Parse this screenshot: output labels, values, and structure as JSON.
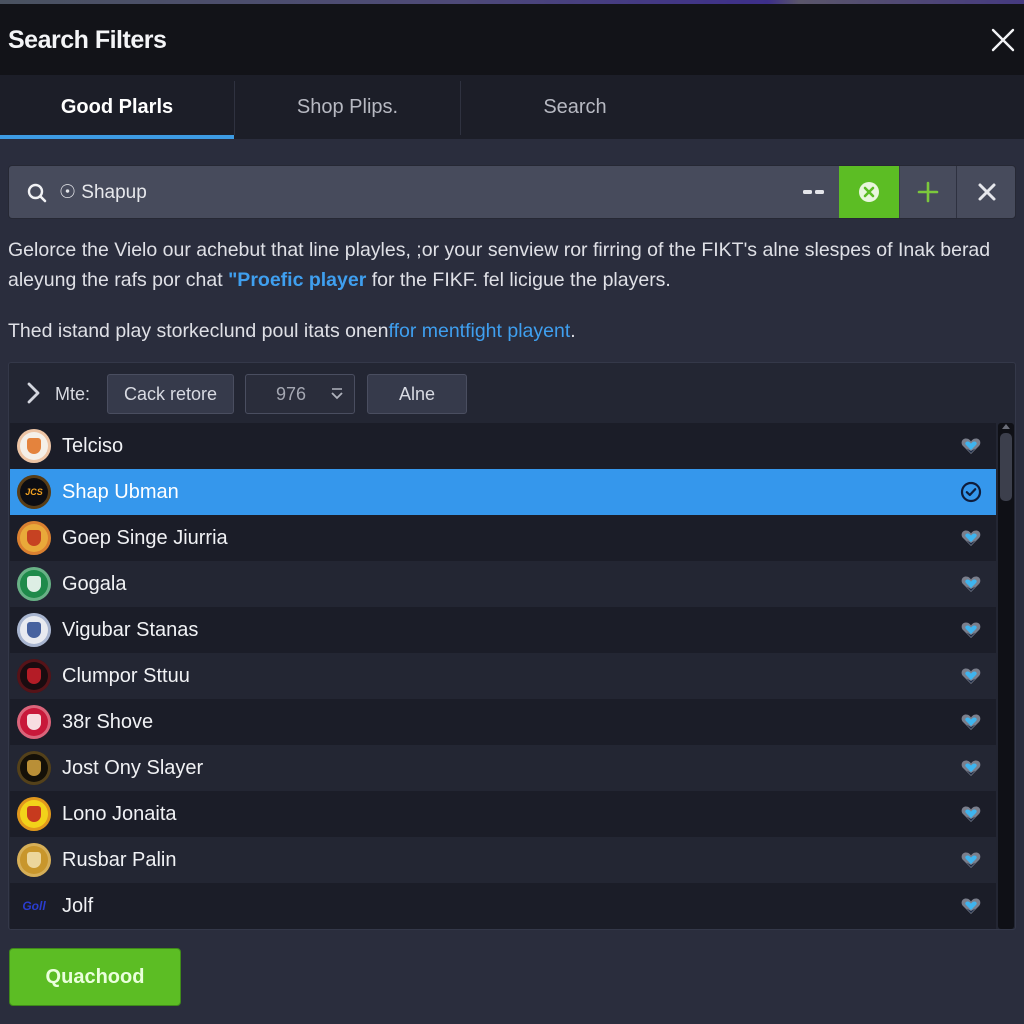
{
  "header": {
    "title": "Search Filters",
    "close_icon": "close-icon"
  },
  "tabs": [
    {
      "label": "Good Plarls",
      "active": true
    },
    {
      "label": "Shop Plips.",
      "active": false
    },
    {
      "label": "Search",
      "active": false
    }
  ],
  "search": {
    "value": "☉ Shapup",
    "placeholder": "",
    "icons": [
      "search-icon",
      "minus-icon",
      "clear-circle-icon",
      "plus-icon",
      "close-icon"
    ]
  },
  "description": {
    "line1": "Gelorce the Vielo our achebut that line playles, ;or your senview ror firring of the FIKT's alne slespes of Inak berad",
    "line2_pre": "aleyung the rafs por chat ",
    "line2_link": "\"Proefic player",
    "line2_post": " for the FIKF. fel licigue the players.",
    "p2_pre": "Thed istand play storkeclund poul itats onen",
    "p2_link": "ffor mentfight playent",
    "p2_post": "."
  },
  "filter_bar": {
    "label": "Mte:",
    "button1": "Cack retore",
    "select_value": "976",
    "button2": "Alne"
  },
  "players": [
    {
      "name": "Telciso",
      "avatar_text": "",
      "avatar_bg": "#f4efe8",
      "avatar_fg": "#e0701e",
      "selected": false,
      "icon": "heart-icon"
    },
    {
      "name": "Shap Ubman",
      "avatar_text": "JCS",
      "avatar_bg": "#0d0d12",
      "avatar_fg": "#f0a020",
      "selected": true,
      "icon": "check-circle-icon"
    },
    {
      "name": "Goep Singe Jiurria",
      "avatar_text": "",
      "avatar_bg": "#e9a93a",
      "avatar_fg": "#c0301e",
      "selected": false,
      "icon": "heart-icon"
    },
    {
      "name": "Gogala",
      "avatar_text": "",
      "avatar_bg": "#1f8a4a",
      "avatar_fg": "#ffffff",
      "selected": false,
      "icon": "heart-icon"
    },
    {
      "name": "Vigubar Stanas",
      "avatar_text": "",
      "avatar_bg": "#e8eaf0",
      "avatar_fg": "#2a4a90",
      "selected": false,
      "icon": "heart-icon"
    },
    {
      "name": "Clumpor Sttuu",
      "avatar_text": "",
      "avatar_bg": "#1a0c10",
      "avatar_fg": "#d0202a",
      "selected": false,
      "icon": "heart-icon"
    },
    {
      "name": "38r Shove",
      "avatar_text": "",
      "avatar_bg": "#c8183a",
      "avatar_fg": "#ffffff",
      "selected": false,
      "icon": "heart-icon"
    },
    {
      "name": "Jost Ony Slayer",
      "avatar_text": "",
      "avatar_bg": "#141008",
      "avatar_fg": "#d6a640",
      "selected": false,
      "icon": "heart-icon"
    },
    {
      "name": "Lono Jonaita",
      "avatar_text": "",
      "avatar_bg": "#f2d21a",
      "avatar_fg": "#c02020",
      "selected": false,
      "icon": "heart-icon"
    },
    {
      "name": "Rusbar Palin",
      "avatar_text": "",
      "avatar_bg": "#c8962c",
      "avatar_fg": "#f2e2b0",
      "selected": false,
      "icon": "heart-icon"
    },
    {
      "name": "Jolf",
      "avatar_text": "Goll",
      "avatar_bg": "transparent",
      "avatar_fg": "#2a3ccf",
      "selected": false,
      "icon": "heart-icon"
    }
  ],
  "primary_button": "Quachood",
  "colors": {
    "accent_blue": "#3597ec",
    "accent_green": "#5cbd24",
    "background": "#2a2d3d",
    "header_bg": "#121318"
  }
}
